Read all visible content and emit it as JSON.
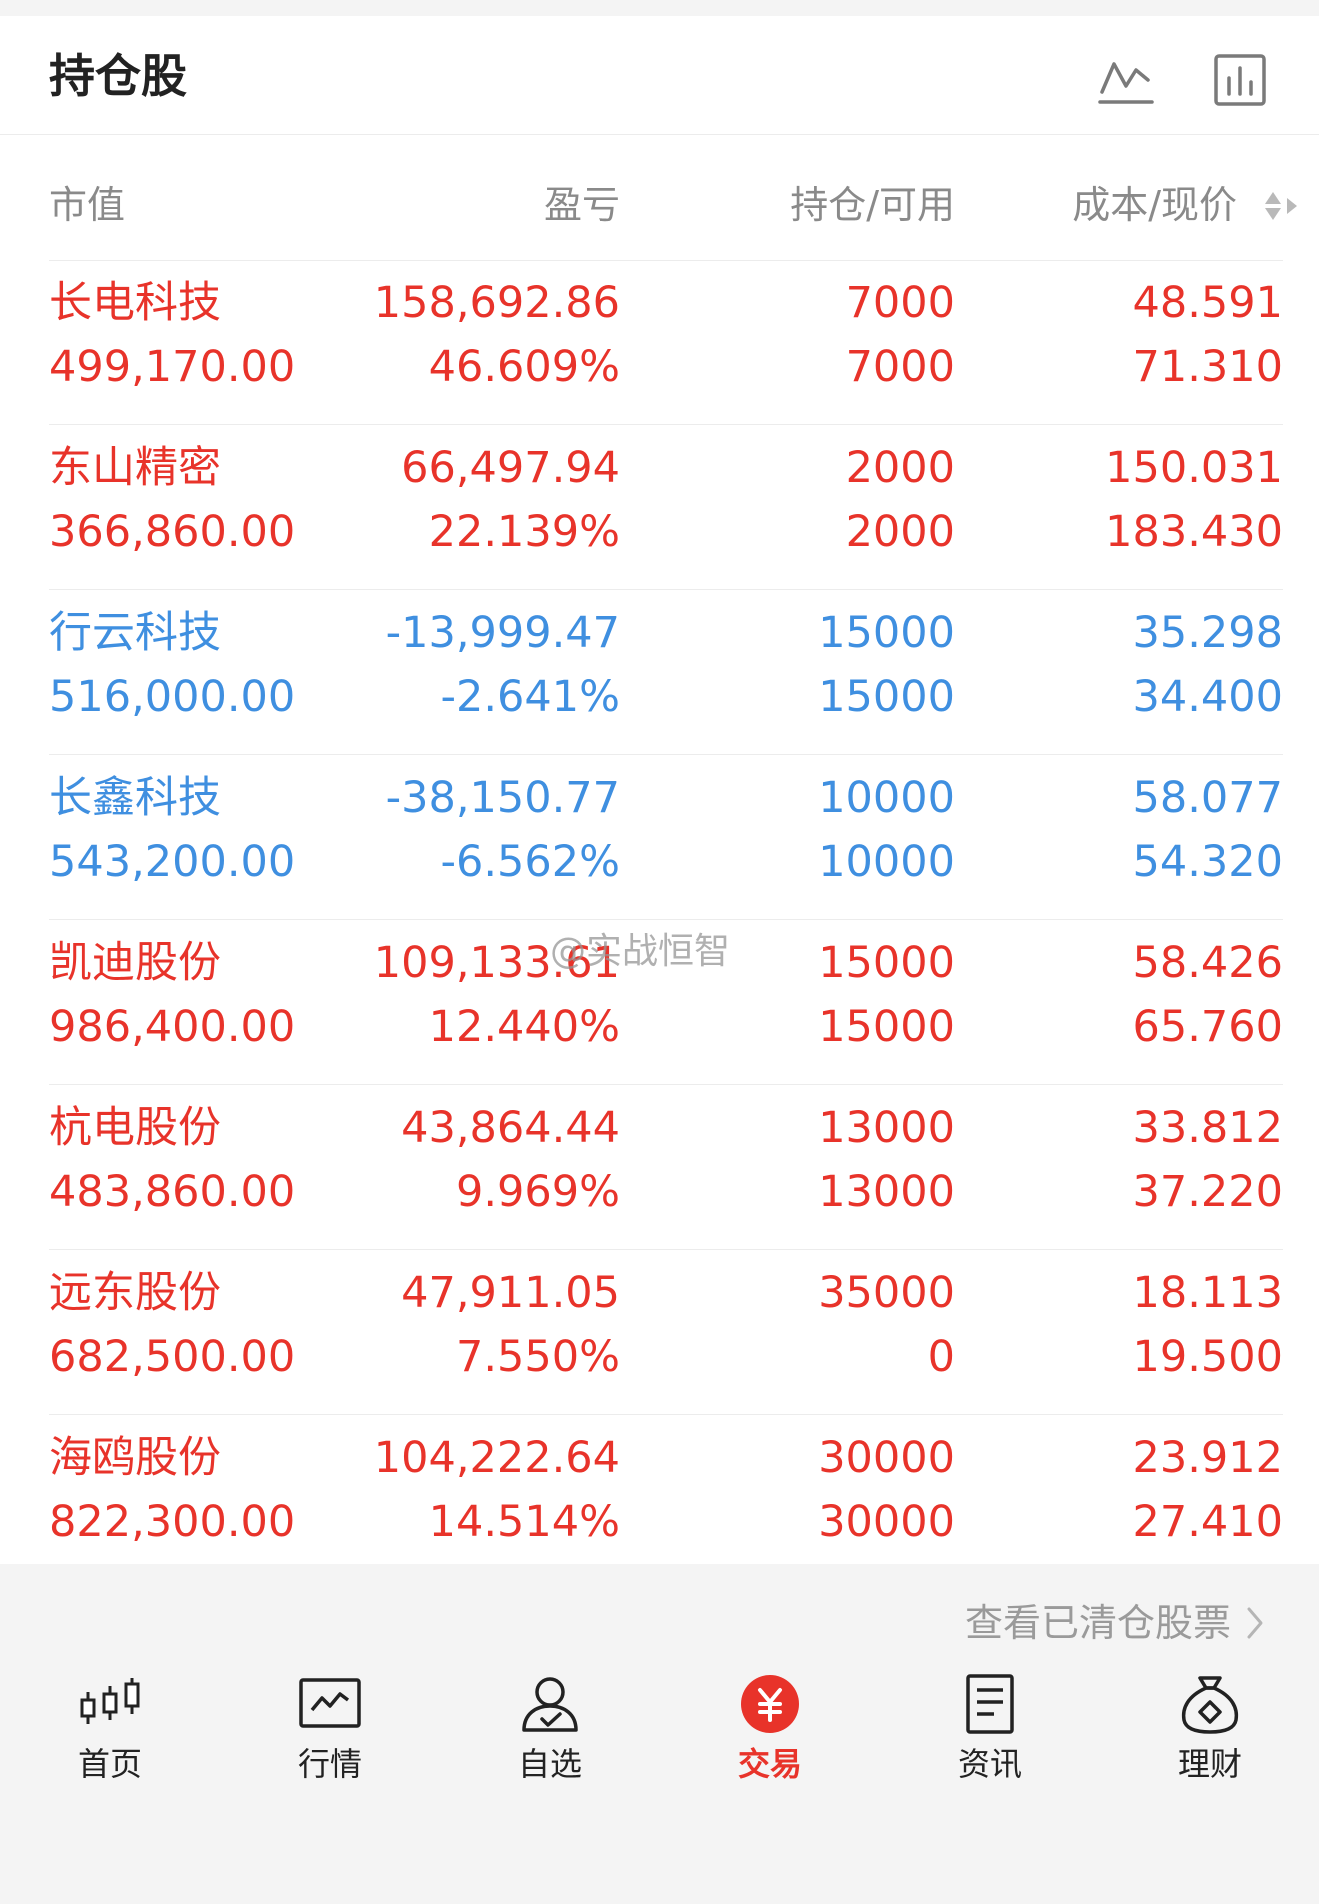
{
  "header": {
    "title": "持仓股",
    "icons": [
      "line-chart-icon",
      "bar-chart-icon"
    ]
  },
  "columns": {
    "market_value": "市值",
    "profit_loss": "盈亏",
    "holding": "持仓/可用",
    "cost_price": "成本/现价"
  },
  "holdings": [
    {
      "name": "长电科技",
      "market_value": "499,170.00",
      "pl": "158,692.86",
      "pl_pct": "46.609%",
      "hold": "7000",
      "avail": "7000",
      "cost": "48.591",
      "price": "71.310",
      "trend": "up"
    },
    {
      "name": "东山精密",
      "market_value": "366,860.00",
      "pl": "66,497.94",
      "pl_pct": "22.139%",
      "hold": "2000",
      "avail": "2000",
      "cost": "150.031",
      "price": "183.430",
      "trend": "up"
    },
    {
      "name": "行云科技",
      "market_value": "516,000.00",
      "pl": "-13,999.47",
      "pl_pct": "-2.641%",
      "hold": "15000",
      "avail": "15000",
      "cost": "35.298",
      "price": "34.400",
      "trend": "down"
    },
    {
      "name": "长鑫科技",
      "market_value": "543,200.00",
      "pl": "-38,150.77",
      "pl_pct": "-6.562%",
      "hold": "10000",
      "avail": "10000",
      "cost": "58.077",
      "price": "54.320",
      "trend": "down"
    },
    {
      "name": "凯迪股份",
      "market_value": "986,400.00",
      "pl": "109,133.61",
      "pl_pct": "12.440%",
      "hold": "15000",
      "avail": "15000",
      "cost": "58.426",
      "price": "65.760",
      "trend": "up"
    },
    {
      "name": "杭电股份",
      "market_value": "483,860.00",
      "pl": "43,864.44",
      "pl_pct": "9.969%",
      "hold": "13000",
      "avail": "13000",
      "cost": "33.812",
      "price": "37.220",
      "trend": "up"
    },
    {
      "name": "远东股份",
      "market_value": "682,500.00",
      "pl": "47,911.05",
      "pl_pct": "7.550%",
      "hold": "35000",
      "avail": "0",
      "cost": "18.113",
      "price": "19.500",
      "trend": "up"
    },
    {
      "name": "海鸥股份",
      "market_value": "822,300.00",
      "pl": "104,222.64",
      "pl_pct": "14.514%",
      "hold": "30000",
      "avail": "30000",
      "cost": "23.912",
      "price": "27.410",
      "trend": "up"
    }
  ],
  "watermark": "@实战恒智",
  "cleared_link": "查看已清仓股票",
  "nav": [
    {
      "label": "首页",
      "icon": "candlestick-icon"
    },
    {
      "label": "行情",
      "icon": "market-chart-icon"
    },
    {
      "label": "自选",
      "icon": "user-check-icon"
    },
    {
      "label": "交易",
      "icon": "yuan-icon",
      "active": true
    },
    {
      "label": "资讯",
      "icon": "document-icon"
    },
    {
      "label": "理财",
      "icon": "money-bag-icon"
    }
  ],
  "colors": {
    "up": "#e8332a",
    "down": "#3f8fe0",
    "text": "#222222",
    "muted": "#8a8a8a"
  }
}
